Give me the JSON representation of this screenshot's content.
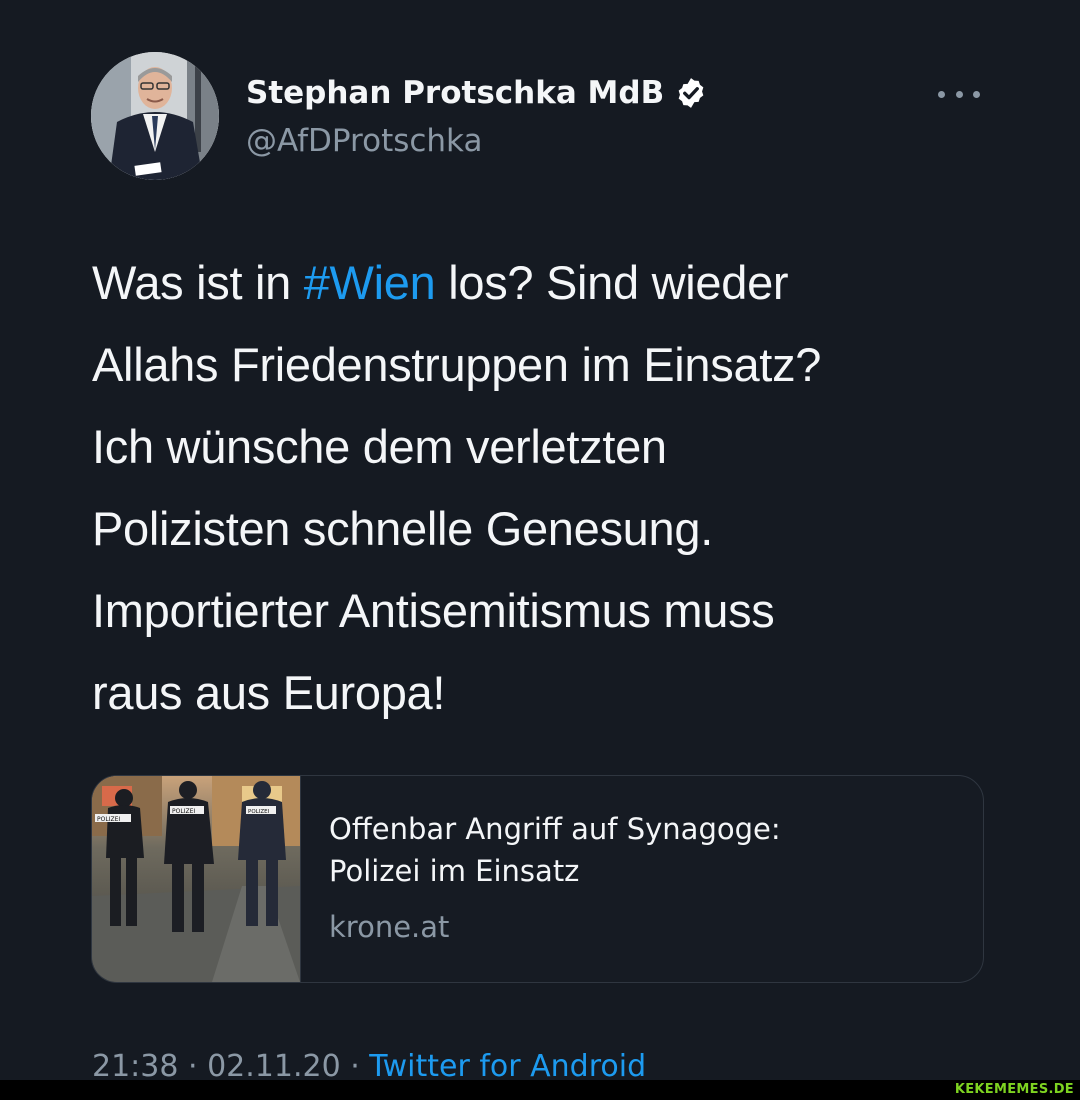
{
  "author": {
    "display_name": "Stephan Protschka MdB",
    "handle": "@AfDProtschka",
    "verified": true
  },
  "tweet": {
    "lines": [
      [
        {
          "text": "Was ist in ",
          "type": "text"
        },
        {
          "text": "#Wien",
          "type": "hashtag"
        },
        {
          "text": " los? Sind wieder",
          "type": "text"
        }
      ],
      [
        {
          "text": "Allahs Friedenstruppen im Einsatz?",
          "type": "text"
        }
      ],
      [
        {
          "text": "Ich wünsche dem verletzten",
          "type": "text"
        }
      ],
      [
        {
          "text": "Polizisten schnelle Genesung.",
          "type": "text"
        }
      ],
      [
        {
          "text": "Importierter Antisemitismus muss",
          "type": "text"
        }
      ],
      [
        {
          "text": "raus aus Europa!",
          "type": "text"
        }
      ]
    ]
  },
  "link_card": {
    "title_lines": [
      "Offenbar Angriff auf Synagoge:",
      "Polizei im Einsatz"
    ],
    "domain": "krone.at",
    "image_badges": [
      "POLIZEI",
      "POLIZEI",
      "POLIZEI"
    ]
  },
  "meta": {
    "time": "21:38",
    "separator": " · ",
    "date": "02.11.20",
    "source": "Twitter for Android"
  },
  "watermark": "KEKEMEMES.DE",
  "colors": {
    "background": "#151a22",
    "text": "#f4f6f8",
    "secondary": "#8b98a5",
    "link": "#1d9bf0",
    "verified": "#ffffff",
    "watermark": "#7ed321"
  },
  "icons": {
    "verified": "verified-badge-icon",
    "more": "more-horizontal-icon"
  }
}
